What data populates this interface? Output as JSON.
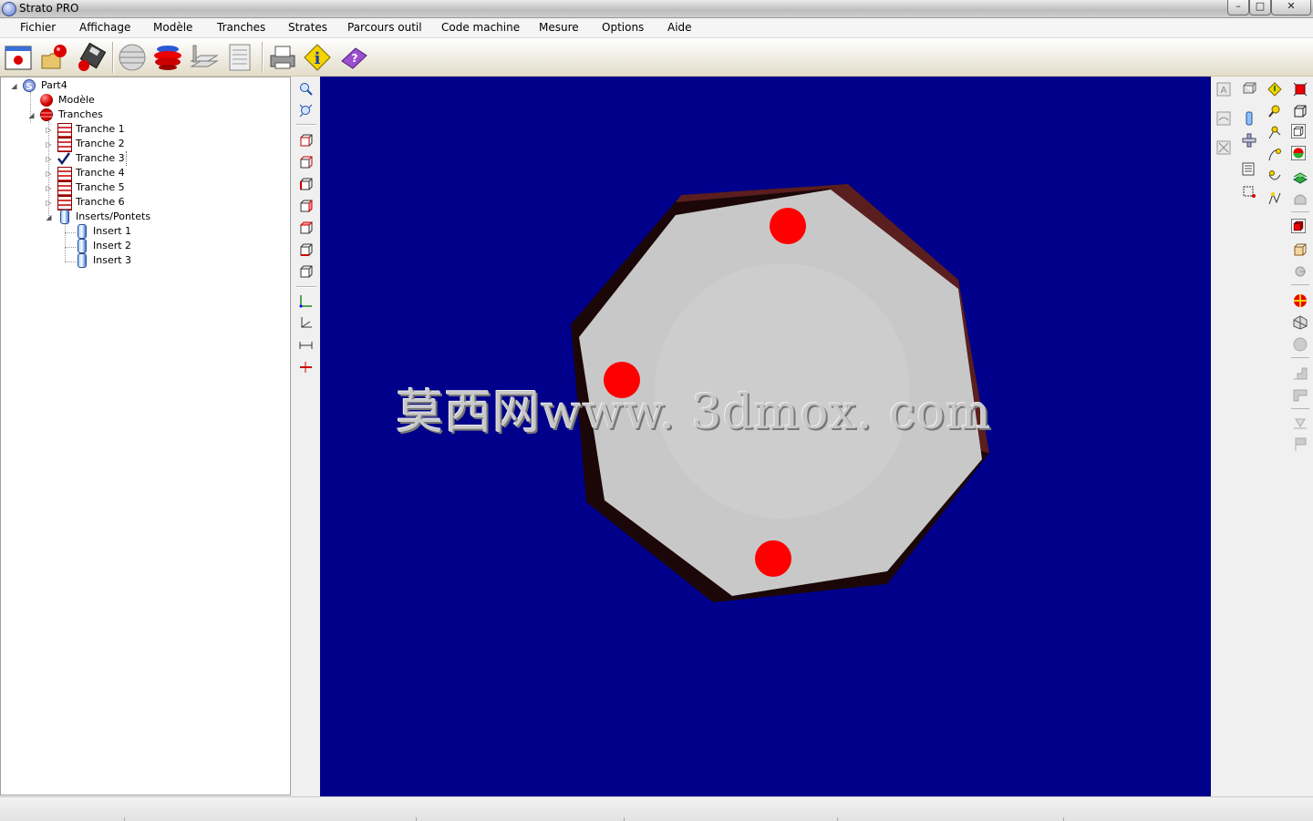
{
  "window": {
    "title": "Strato PRO",
    "controls": {
      "minimize": "–",
      "maximize": "□",
      "close": "✕"
    }
  },
  "menu": [
    "Fichier",
    "Affichage",
    "Modèle",
    "Tranches",
    "Strates",
    "Parcours outil",
    "Code machine",
    "Mesure",
    "Options",
    "Aide"
  ],
  "toolbar": {
    "icons": [
      "new-part-icon",
      "open-model-icon",
      "save-disk-icon",
      "slicing-sphere-icon",
      "sliced-model-icon",
      "layers-stack-icon",
      "nc-table-icon",
      "printer-icon",
      "info-icon",
      "help-book-icon"
    ]
  },
  "tree": {
    "root": "Part4",
    "model": "Modèle",
    "slices_group": "Tranches",
    "slices": [
      "Tranche 1",
      "Tranche 2",
      "Tranche 3",
      "Tranche 4",
      "Tranche 5",
      "Tranche 6"
    ],
    "checked_slice_index": 2,
    "inserts_group": "Inserts/Pontets",
    "inserts": [
      "Insert 1",
      "Insert 2",
      "Insert 3"
    ]
  },
  "viewport": {
    "background_color": "#00008b",
    "watermark": "莫西网www. 3dmox. com",
    "model_face_color": "#c8c8c8",
    "model_side_color": "#5a1e1e",
    "insert_marker_color": "#ff0000"
  }
}
